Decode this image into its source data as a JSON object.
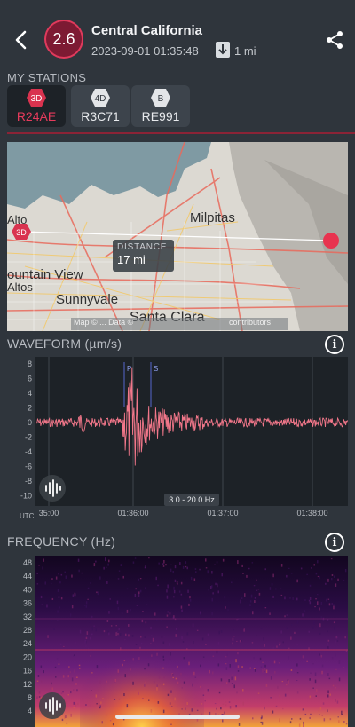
{
  "header": {
    "magnitude": "2.6",
    "title": "Central California",
    "datetime": "2023-09-01 01:35:48",
    "distance": "1 mi"
  },
  "stations": {
    "label": "MY STATIONS",
    "items": [
      {
        "badge": "3D",
        "code": "R24AE",
        "active": true
      },
      {
        "badge": "4D",
        "code": "R3C71",
        "active": false
      },
      {
        "badge": "B",
        "code": "RE991",
        "active": false
      }
    ]
  },
  "map": {
    "places": [
      "Alto",
      "Milpitas",
      "ountain View",
      "Altos",
      "Sunnyvale",
      "Santa Clara"
    ],
    "station_marker": "3D",
    "distance_label": "DISTANCE",
    "distance_value": "17 mi",
    "attribution_left": "Map © ... Data ©",
    "attribution_right": "contributors"
  },
  "waveform": {
    "label": "WAVEFORM (µm/s)",
    "y_ticks": [
      "8",
      "6",
      "4",
      "2",
      "0",
      "-2",
      "-4",
      "-6",
      "-8",
      "-10"
    ],
    "x_ticks": [
      "35:00",
      "01:36:00",
      "01:37:00",
      "01:38:00"
    ],
    "utc": "UTC",
    "p_label": "P",
    "s_label": "S",
    "filter": "3.0 - 20.0 Hz",
    "color": "#f2778a"
  },
  "frequency": {
    "label": "FREQUENCY (Hz)",
    "y_ticks": [
      "48",
      "44",
      "40",
      "36",
      "32",
      "28",
      "24",
      "20",
      "16",
      "12",
      "8",
      "4"
    ]
  }
}
